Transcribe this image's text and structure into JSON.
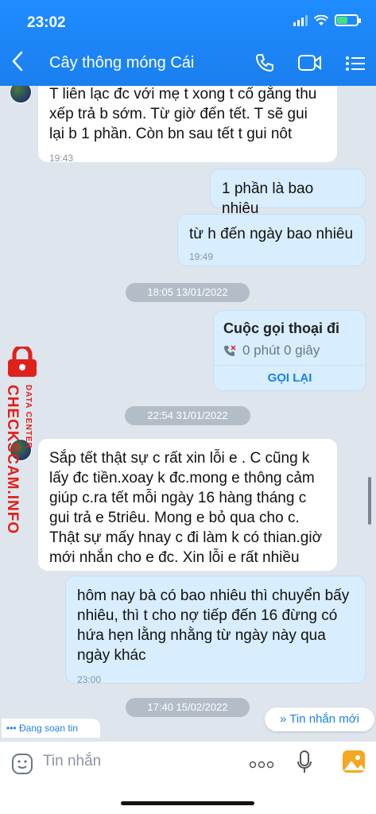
{
  "status": {
    "time": "23:02"
  },
  "header": {
    "title": "Cây thông móng Cái"
  },
  "messages": [
    {
      "text": "T liên lạc đc với mẹ t xong t cố gắng thu xếp trả b sớm. Từ giờ đến tết. T sẽ gui lại b 1 phần. Còn bn sau tết t gui nôt",
      "time": "19:43"
    },
    {
      "text": "1 phần là bao nhiêu"
    },
    {
      "text": "từ h đến ngày bao nhiêu",
      "time": "19:49"
    },
    {
      "text": "Sắp tết thật sự c rất xin lỗi e . C cũng k lấy đc tiền.xoay k đc.mong e thông cảm giúp c.ra tết mỗi ngày 16 hàng tháng c gui trả e 5triêu. Mong e bỏ qua cho c. Thật sự mấy hnay c đi làm k có thian.giờ mới nhắn cho e đc. Xin lỗi e rất nhiều"
    },
    {
      "text": "hôm nay bà có bao nhiêu thì chuyển bấy nhiêu, thì t cho nợ tiếp đến 16 đừng có hứa hẹn lằng nhằng từ ngày này qua ngày khác",
      "time": "23:00"
    }
  ],
  "date_separators": [
    "18:05 13/01/2022",
    "22:54 31/01/2022",
    "17:40 15/02/2022"
  ],
  "call": {
    "title": "Cuộc gọi thoại đi",
    "duration": "0 phút 0 giây",
    "callback": "GỌI LẠI"
  },
  "watermark": {
    "main": "CHECKSCAM.INFO",
    "small": "DATA CENTER"
  },
  "typing": "Đang soạn tin",
  "new_message_button": "Tin nhắn mới",
  "input": {
    "placeholder": "Tin nhắn"
  },
  "colors": {
    "accent": "#1a7fef",
    "watermark": "#e0201b"
  }
}
